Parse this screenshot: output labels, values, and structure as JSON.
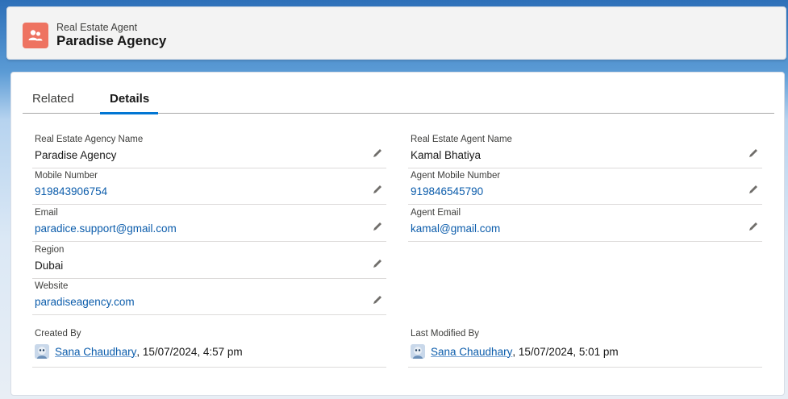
{
  "header": {
    "object_label": "Real Estate Agent",
    "record_name": "Paradise Agency",
    "icon": "people-icon",
    "icon_color": "#ee7361"
  },
  "tabs": [
    {
      "label": "Related",
      "active": false
    },
    {
      "label": "Details",
      "active": true
    }
  ],
  "accent_color": "#0176d3",
  "fields_left": [
    {
      "label": "Real Estate Agency Name",
      "value": "Paradise Agency",
      "link": false
    },
    {
      "label": "Mobile Number",
      "value": "919843906754",
      "link": true
    },
    {
      "label": "Email",
      "value": "paradice.support@gmail.com",
      "link": true
    },
    {
      "label": "Region",
      "value": "Dubai",
      "link": false
    },
    {
      "label": "Website",
      "value": "paradiseagency.com",
      "link": true
    }
  ],
  "fields_right": [
    {
      "label": "Real Estate Agent Name",
      "value": "Kamal Bhatiya",
      "link": false
    },
    {
      "label": "Agent Mobile Number",
      "value": "919846545790",
      "link": true
    },
    {
      "label": "Agent Email",
      "value": "kamal@gmail.com",
      "link": true
    }
  ],
  "system": {
    "created_by": {
      "label": "Created By",
      "user": "Sana Chaudhary",
      "timestamp": ", 15/07/2024, 4:57 pm"
    },
    "last_modified_by": {
      "label": "Last Modified By",
      "user": "Sana Chaudhary",
      "timestamp": ", 15/07/2024, 5:01 pm"
    }
  }
}
